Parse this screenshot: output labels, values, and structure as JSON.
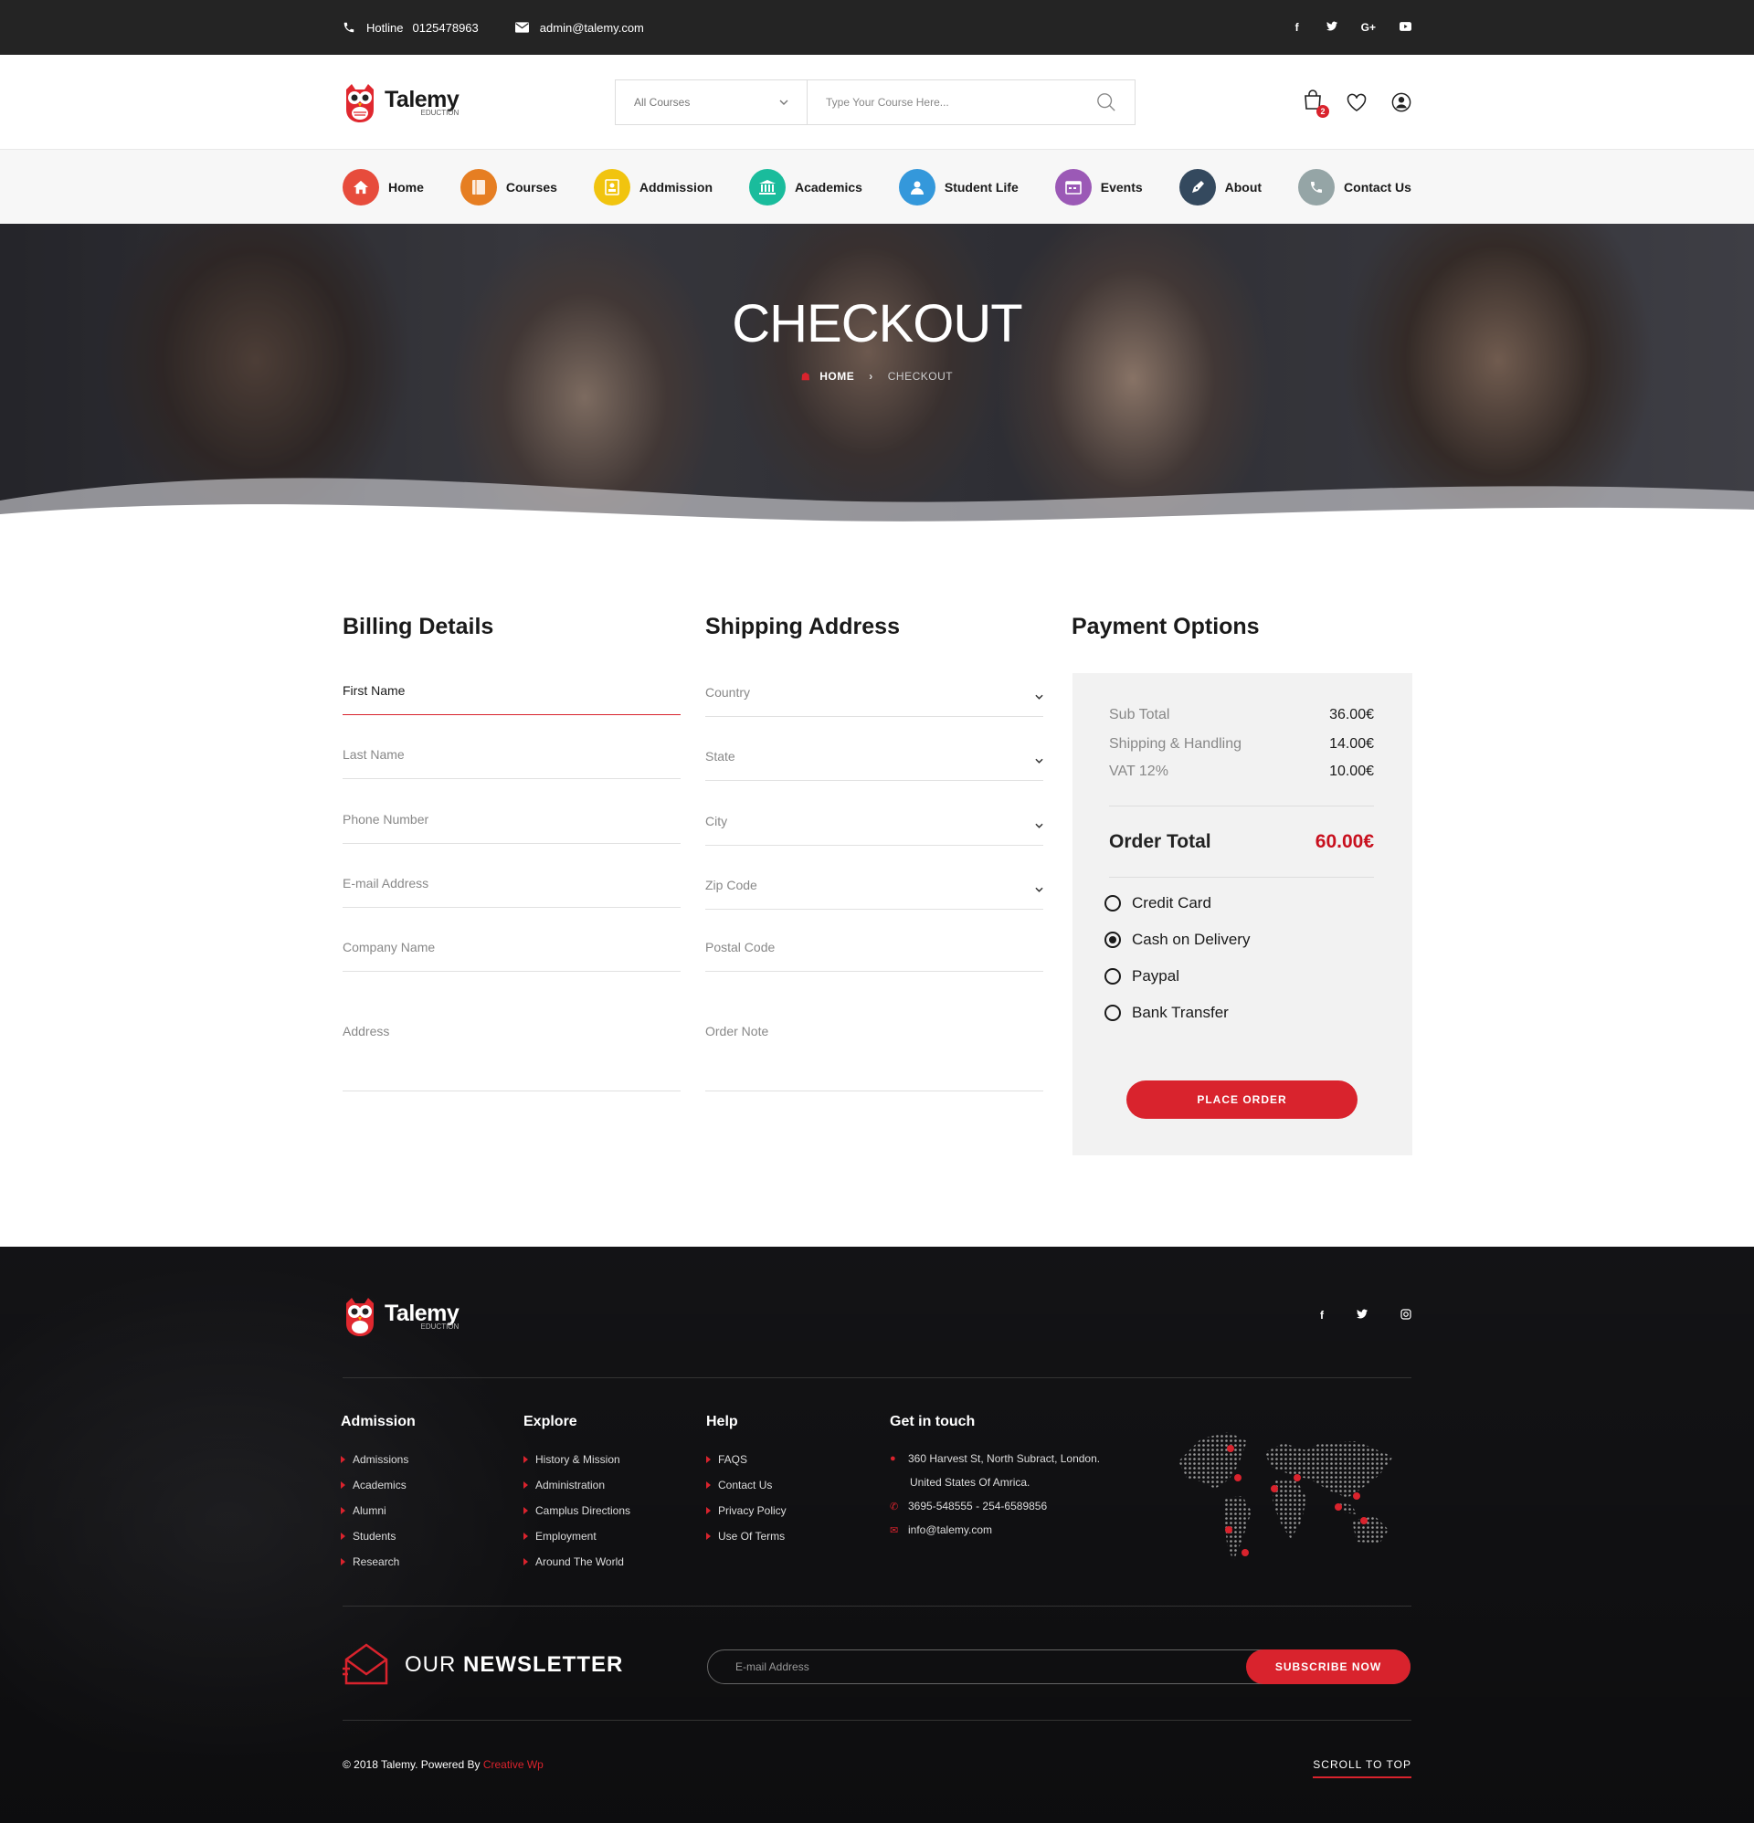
{
  "topbar": {
    "hotline_label": "Hotline",
    "hotline_number": "0125478963",
    "email": "admin@talemy.com",
    "social": [
      "f",
      "t",
      "G+",
      "yt"
    ]
  },
  "header": {
    "brand": "Talemy",
    "brand_sub": "EDUCTION",
    "category_select": "All Courses",
    "search_placeholder": "Type Your Course Here...",
    "cart_count": "2"
  },
  "nav": [
    {
      "label": "Home",
      "icon": "home-icon",
      "color": "#e74c3c"
    },
    {
      "label": "Courses",
      "icon": "book-icon",
      "color": "#e67e22"
    },
    {
      "label": "Addmission",
      "icon": "id-card-icon",
      "color": "#f1c40f"
    },
    {
      "label": "Academics",
      "icon": "institution-icon",
      "color": "#1abc9c"
    },
    {
      "label": "Student Life",
      "icon": "user-icon",
      "color": "#3498db"
    },
    {
      "label": "Events",
      "icon": "calendar-icon",
      "color": "#9b59b6"
    },
    {
      "label": "About",
      "icon": "pen-icon",
      "color": "#34495e"
    },
    {
      "label": "Contact Us",
      "icon": "phone-icon",
      "color": "#95a5a6"
    }
  ],
  "hero": {
    "title": "CHECKOUT",
    "crumb_home": "HOME",
    "crumb_current": "CHECKOUT"
  },
  "billing": {
    "title": "Billing Details",
    "fields": [
      "First Name",
      "Last Name",
      "Phone Number",
      "E-mail Address",
      "Company Name",
      "Address"
    ]
  },
  "shipping": {
    "title": "Shipping Address",
    "fields": [
      "Country",
      "State",
      "City",
      "Zip Code",
      "Postal Code",
      "Order Note"
    ]
  },
  "payment": {
    "title": "Payment Options",
    "sub_total_label": "Sub Total",
    "sub_total": "36.00€",
    "shipping_label": "Shipping & Handling",
    "shipping": "14.00€",
    "vat_label": "VAT 12%",
    "vat": "10.00€",
    "order_total_label": "Order Total",
    "order_total": "60.00€",
    "options": [
      "Credit Card",
      "Cash on Delivery",
      "Paypal",
      "Bank Transfer"
    ],
    "selected": "Cash on Delivery",
    "place_order": "PLACE ORDER"
  },
  "footer": {
    "brand": "Talemy",
    "brand_sub": "EDUCTION",
    "social": [
      "f",
      "t",
      "ig"
    ],
    "admission": {
      "title": "Admission",
      "items": [
        "Admissions",
        "Academics",
        "Alumni",
        "Students",
        "Research"
      ]
    },
    "explore": {
      "title": "Explore",
      "items": [
        "History & Mission",
        "Administration",
        "Camplus Directions",
        "Employment",
        "Around The World"
      ]
    },
    "help": {
      "title": "Help",
      "items": [
        "FAQS",
        "Contact Us",
        "Privacy Policy",
        "Use Of Terms"
      ]
    },
    "contact": {
      "title": "Get in touch",
      "address1": "360 Harvest St, North Subract, London.",
      "address2": "United States Of Amrica.",
      "phone": "3695-548555   -   254-6589856",
      "email": "info@talemy.com"
    },
    "newsletter_prefix": "OUR ",
    "newsletter_bold": "NEWSLETTER",
    "newsletter_placeholder": "E-mail Address",
    "subscribe": "SUBSCRIBE NOW",
    "copyright": "© 2018 Talemy.  Powered By ",
    "powered_by": "Creative Wp",
    "scroll_top": "SCROLL TO TOP"
  },
  "colors": {
    "accent": "#d9232d",
    "dark": "#242424"
  }
}
